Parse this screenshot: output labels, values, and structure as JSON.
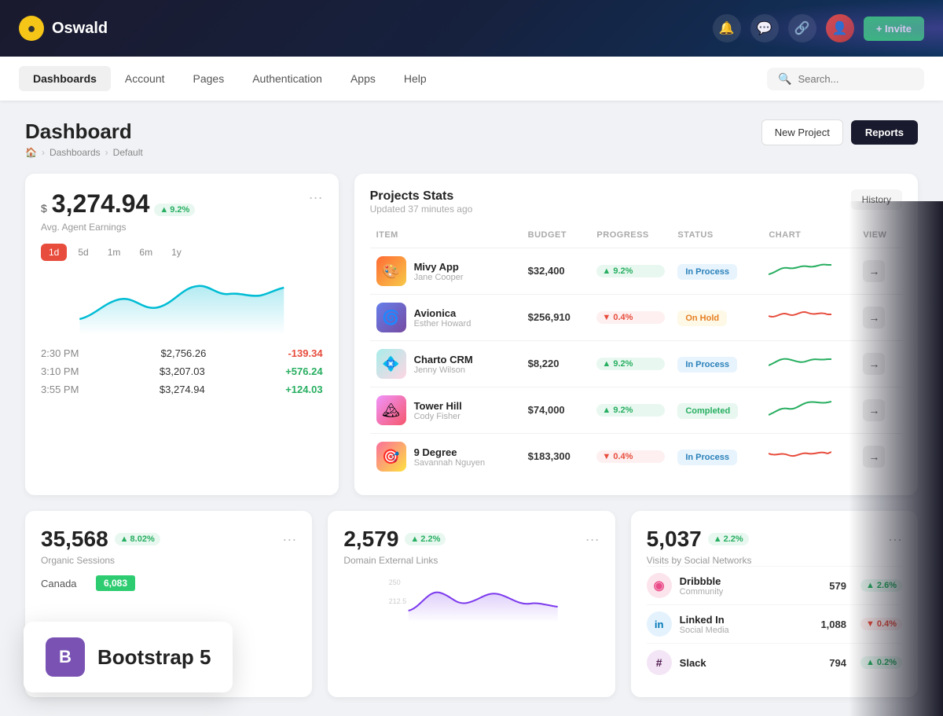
{
  "header": {
    "logo_letter": "O",
    "logo_text": "Oswald",
    "invite_label": "+ Invite"
  },
  "nav": {
    "items": [
      {
        "id": "dashboards",
        "label": "Dashboards",
        "active": true
      },
      {
        "id": "account",
        "label": "Account",
        "active": false
      },
      {
        "id": "pages",
        "label": "Pages",
        "active": false
      },
      {
        "id": "authentication",
        "label": "Authentication",
        "active": false
      },
      {
        "id": "apps",
        "label": "Apps",
        "active": false
      },
      {
        "id": "help",
        "label": "Help",
        "active": false
      }
    ],
    "search_placeholder": "Search..."
  },
  "page": {
    "title": "Dashboard",
    "breadcrumb": [
      "🏠",
      "Dashboards",
      "Default"
    ],
    "actions": {
      "new_project": "New Project",
      "reports": "Reports"
    }
  },
  "earnings_card": {
    "currency": "$",
    "amount": "3,274.94",
    "badge": "9.2%",
    "label": "Avg. Agent Earnings",
    "time_tabs": [
      "1d",
      "5d",
      "1m",
      "6m",
      "1y"
    ],
    "active_tab": "1d",
    "rows": [
      {
        "time": "2:30 PM",
        "value": "$2,756.26",
        "change": "-139.34",
        "positive": false
      },
      {
        "time": "3:10 PM",
        "value": "$3,207.03",
        "change": "+576.24",
        "positive": true
      },
      {
        "time": "3:55 PM",
        "value": "$3,274.94",
        "change": "+124.03",
        "positive": true
      }
    ]
  },
  "projects_card": {
    "title": "Projects Stats",
    "updated": "Updated 37 minutes ago",
    "history_btn": "History",
    "columns": [
      "ITEM",
      "BUDGET",
      "PROGRESS",
      "STATUS",
      "CHART",
      "VIEW"
    ],
    "rows": [
      {
        "name": "Mivy App",
        "owner": "Jane Cooper",
        "budget": "$32,400",
        "progress": "9.2%",
        "progress_up": true,
        "status": "In Process",
        "status_type": "inprocess",
        "emoji": "🎨"
      },
      {
        "name": "Avionica",
        "owner": "Esther Howard",
        "budget": "$256,910",
        "progress": "0.4%",
        "progress_up": false,
        "status": "On Hold",
        "status_type": "onhold",
        "emoji": "🌀"
      },
      {
        "name": "Charto CRM",
        "owner": "Jenny Wilson",
        "budget": "$8,220",
        "progress": "9.2%",
        "progress_up": true,
        "status": "In Process",
        "status_type": "inprocess",
        "emoji": "💠"
      },
      {
        "name": "Tower Hill",
        "owner": "Cody Fisher",
        "budget": "$74,000",
        "progress": "9.2%",
        "progress_up": true,
        "status": "Completed",
        "status_type": "completed",
        "emoji": "🏔"
      },
      {
        "name": "9 Degree",
        "owner": "Savannah Nguyen",
        "budget": "$183,300",
        "progress": "0.4%",
        "progress_up": false,
        "status": "In Process",
        "status_type": "inprocess",
        "emoji": "🎯"
      }
    ]
  },
  "organic_card": {
    "value": "35,568",
    "badge": "8.02%",
    "label": "Organic Sessions"
  },
  "domain_card": {
    "value": "2,579",
    "badge": "2.2%",
    "label": "Domain External Links"
  },
  "social_card": {
    "value": "5,037",
    "badge": "2.2%",
    "label": "Visits by Social Networks",
    "networks": [
      {
        "name": "Dribbble",
        "sub": "Community",
        "count": "579",
        "badge": "2.6%",
        "up": true,
        "color": "#ea4c89"
      },
      {
        "name": "Linked In",
        "sub": "Social Media",
        "count": "1,088",
        "badge": "0.4%",
        "up": false,
        "color": "#0077b5"
      },
      {
        "name": "Slack",
        "sub": "",
        "count": "794",
        "badge": "0.2%",
        "up": true,
        "color": "#4a154b"
      }
    ]
  },
  "country_row": {
    "name": "Canada",
    "value": "6,083"
  },
  "bootstrap_badge": {
    "letter": "B",
    "text": "Bootstrap 5"
  }
}
